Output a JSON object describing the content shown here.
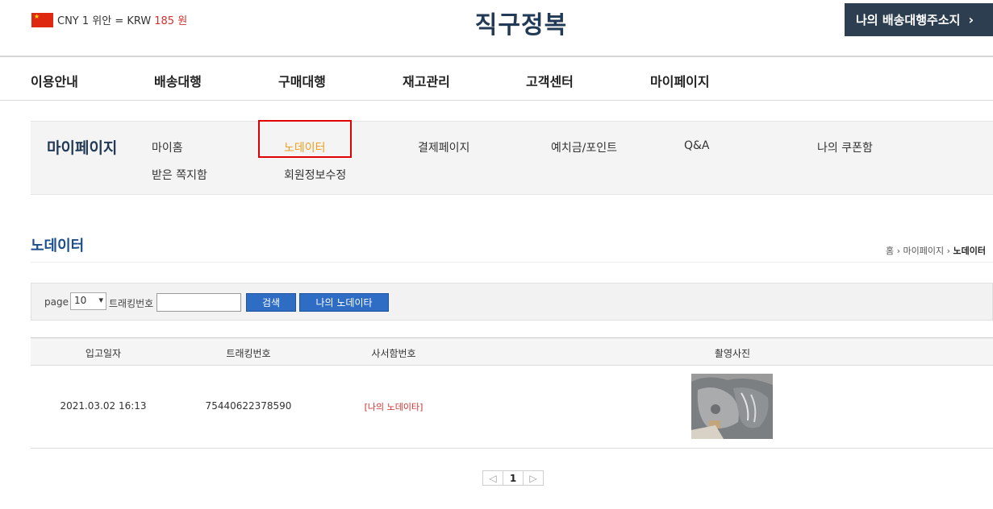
{
  "header": {
    "rate_prefix": "CNY 1 위안 = KRW",
    "rate_value": "185 원",
    "logo": "직구정복",
    "address_button": "나의 배송대행주소지"
  },
  "main_nav": [
    "이용안내",
    "배송대행",
    "구매대행",
    "재고관리",
    "고객센터",
    "마이페이지"
  ],
  "sub_nav": {
    "title": "마이페이지",
    "items": [
      "마이홈",
      "노데이터",
      "결제페이지",
      "예치금/포인트",
      "Q&A",
      "나의 쿠폰함",
      "받은 쪽지함",
      "회원정보수정"
    ],
    "active": "노데이터"
  },
  "page": {
    "title": "노데이터",
    "breadcrumb": [
      "홈",
      "마이페이지",
      "노데이터"
    ]
  },
  "search": {
    "page_label": "page",
    "page_size": "10",
    "tracking_label": "트래킹번호",
    "tracking_value": "",
    "search_button": "검색",
    "my_button": "나의 노데이타"
  },
  "table": {
    "headers": [
      "입고일자",
      "트래킹번호",
      "사서함번호",
      "촬영사진"
    ],
    "rows": [
      {
        "date": "2021.03.02 16:13",
        "tracking": "75440622378590",
        "mailbox": "[나의 노데이타]",
        "photo": "gray-clothing-photo"
      }
    ]
  },
  "pagination": {
    "prev": "◁",
    "current": "1",
    "next": "▷"
  },
  "colors": {
    "brand_dark": "#223a56",
    "accent_orange": "#f0a020",
    "button_blue": "#2f6cc3",
    "alert_red": "#d32f2f"
  }
}
